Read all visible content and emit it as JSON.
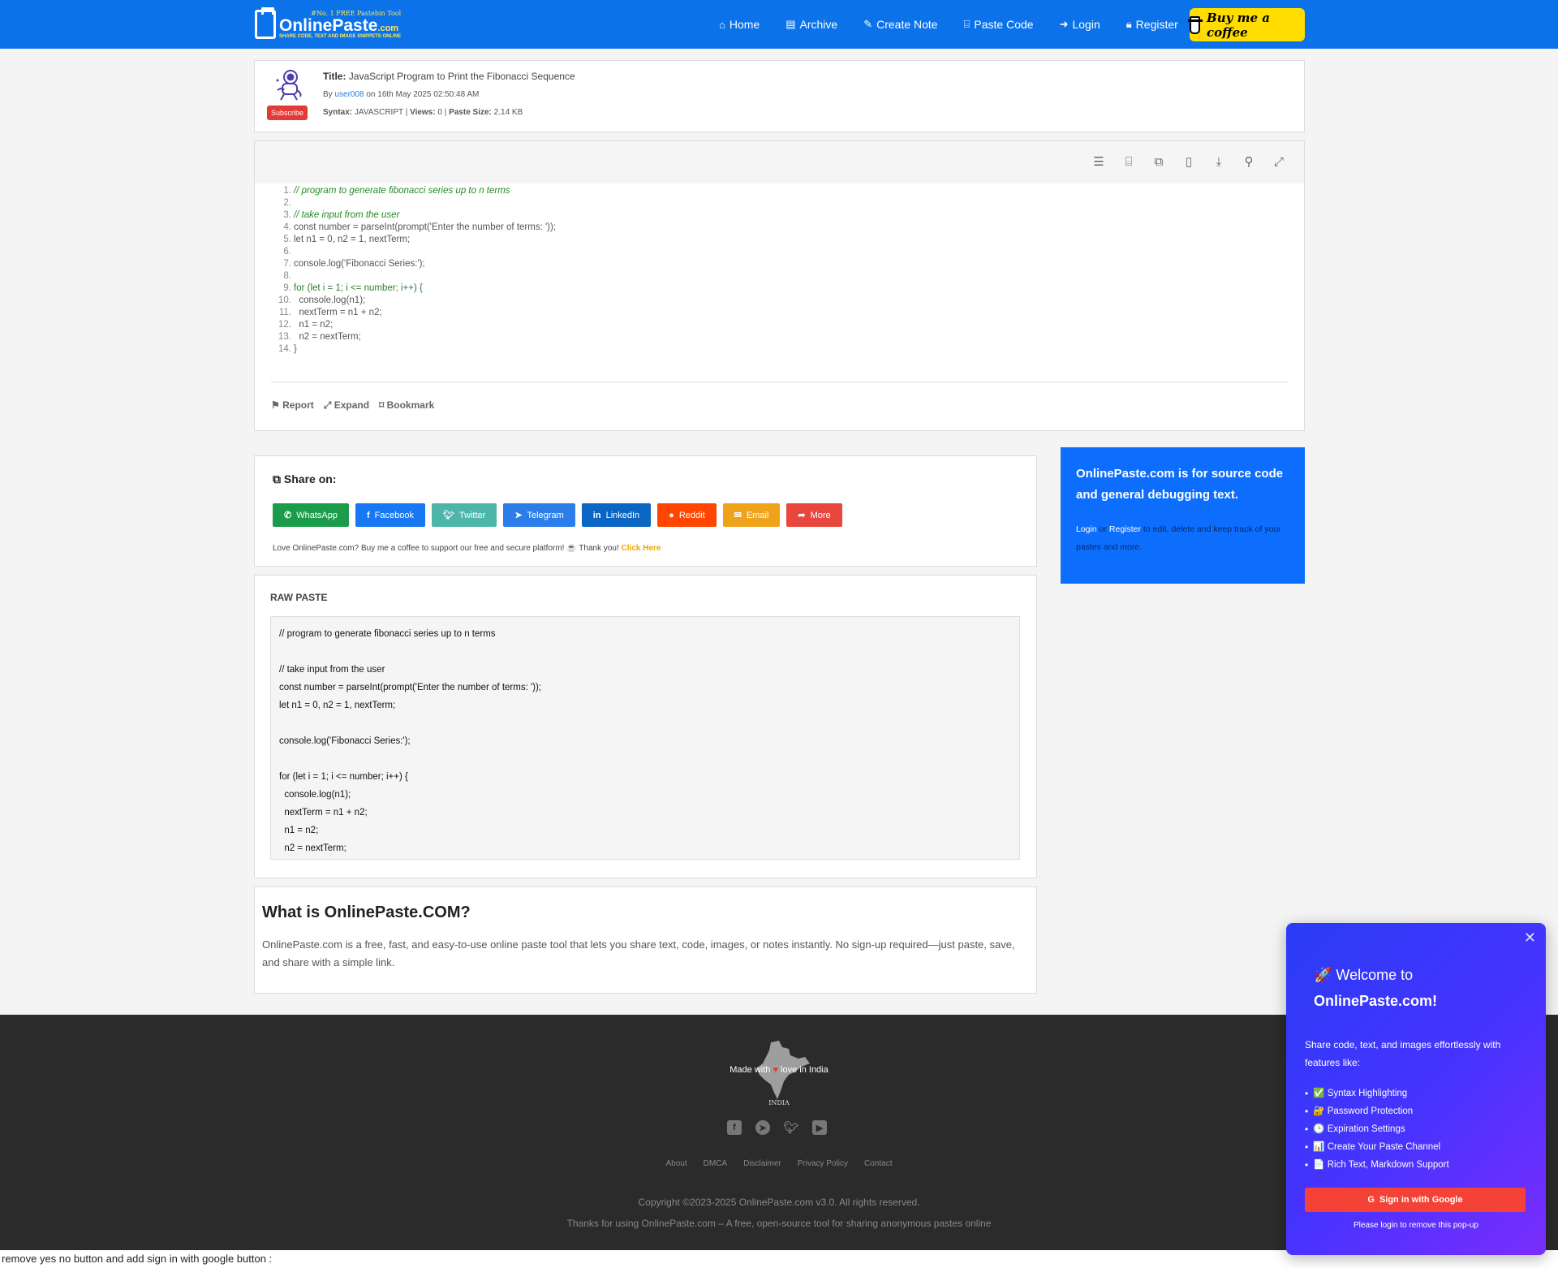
{
  "nav": {
    "logo_tag": "#No. 1 FREE Pastebin Tool",
    "logo_name": "OnlinePaste",
    "logo_dot": ".com",
    "logo_sub": "SHARE CODE, TEXT AND IMAGE SNIPPETS ONLINE",
    "links": [
      {
        "label": "Home",
        "icon": "home-icon"
      },
      {
        "label": "Archive",
        "icon": "archive-icon"
      },
      {
        "label": "Create Note",
        "icon": "edit-icon"
      },
      {
        "label": "Paste Code",
        "icon": "code-file-icon"
      },
      {
        "label": "Login",
        "icon": "sign-in-icon"
      },
      {
        "label": "Register",
        "icon": "lock-icon"
      }
    ],
    "coffee_label": "Buy me a coffee"
  },
  "paste": {
    "subscribe_label": "Subscribe",
    "title_label": "Title:",
    "title": "JavaScript Program to Print the Fibonacci Sequence",
    "by_prefix": "By",
    "author": "user008",
    "date_text": "on 16th May 2025 02:50:48 AM",
    "syntax_label": "Syntax:",
    "syntax": "JAVASCRIPT",
    "views_label": "Views:",
    "views": "0",
    "size_label": "Paste Size:",
    "size": "2.14 KB"
  },
  "toolbar_icons": [
    "list-numbered-icon",
    "code-file-icon",
    "copy-icon",
    "document-icon",
    "download-icon",
    "search-icon",
    "expand-icon"
  ],
  "code_lines": [
    "// program to generate fibonacci series up to n terms",
    "",
    "// take input from the user",
    "const number = parseInt(prompt('Enter the number of terms: '));",
    "let n1 = 0, n2 = 1, nextTerm;",
    "",
    "console.log('Fibonacci Series:');",
    "",
    "for (let i = 1; i <= number; i++) {",
    "  console.log(n1);",
    "  nextTerm = n1 + n2;",
    "  n1 = n2;",
    "  n2 = nextTerm;",
    "}"
  ],
  "code_actions": {
    "report": "Report",
    "expand": "Expand",
    "bookmark": "Bookmark"
  },
  "share": {
    "title": "Share on:",
    "buttons": [
      {
        "label": "WhatsApp",
        "color": "#1a9c4b",
        "icon": "whatsapp-icon"
      },
      {
        "label": "Facebook",
        "color": "#1877f2",
        "icon": "facebook-icon"
      },
      {
        "label": "Twitter",
        "color": "#4db6a9",
        "icon": "twitter-icon"
      },
      {
        "label": "Telegram",
        "color": "#2b7de9",
        "icon": "telegram-icon"
      },
      {
        "label": "LinkedIn",
        "color": "#0a66c2",
        "icon": "linkedin-icon"
      },
      {
        "label": "Reddit",
        "color": "#ff4500",
        "icon": "reddit-icon"
      },
      {
        "label": "Email",
        "color": "#f0a21b",
        "icon": "email-icon"
      },
      {
        "label": "More",
        "color": "#e8473d",
        "icon": "share-icon"
      }
    ],
    "note": "Love OnlinePaste.com? Buy me a coffee to support our free and secure platform! ☕ Thank you!",
    "note_link": "Click Here"
  },
  "sidebar": {
    "heading": "OnlinePaste.com is for source code and general debugging text.",
    "login": "Login",
    "or": "or",
    "register": "Register",
    "rest": "to edit, delete and keep track of your pastes and more."
  },
  "raw": {
    "title": "RAW PASTE",
    "lines": [
      "// program to generate fibonacci series up to n terms",
      "",
      "// take input from the user",
      "const number = parseInt(prompt('Enter the number of terms: '));",
      "let n1 = 0, n2 = 1, nextTerm;",
      "",
      "console.log('Fibonacci Series:');",
      "",
      "for (let i = 1; i <= number; i++) {",
      "  console.log(n1);",
      "  nextTerm = n1 + n2;",
      "  n1 = n2;",
      "  n2 = nextTerm;"
    ]
  },
  "about": {
    "title": "What is OnlinePaste.COM?",
    "text": "OnlinePaste.com is a free, fast, and easy-to-use online paste tool that lets you share text, code, images, or notes instantly. No sign-up required—just paste, save, and share with a simple link."
  },
  "footer": {
    "made_prefix": "Made with",
    "made_suffix": "love in India",
    "india_label": "INDIA",
    "links": [
      "About",
      "DMCA",
      "Disclaimer",
      "Privacy Policy",
      "Contact"
    ],
    "copyright": "Copyright ©2023-2025 OnlinePaste.com v3.0. All rights reserved.",
    "thanks": "Thanks for using OnlinePaste.com – A free, open-source tool for sharing anonymous pastes online"
  },
  "bottom_text": "remove yes no button and add sign in with google button :",
  "popup": {
    "title_prefix": "🚀 Welcome to",
    "title_bold": "OnlinePaste.com!",
    "desc": "Share code, text, and images effortlessly with features like:",
    "features": [
      "✅ Syntax Highlighting",
      "🔐 Password Protection",
      "🕒 Expiration Settings",
      "📊 Create Your Paste Channel",
      "📄 Rich Text, Markdown Support"
    ],
    "google_label": "Sign in with Google",
    "note": "Please login to remove this pop-up"
  }
}
